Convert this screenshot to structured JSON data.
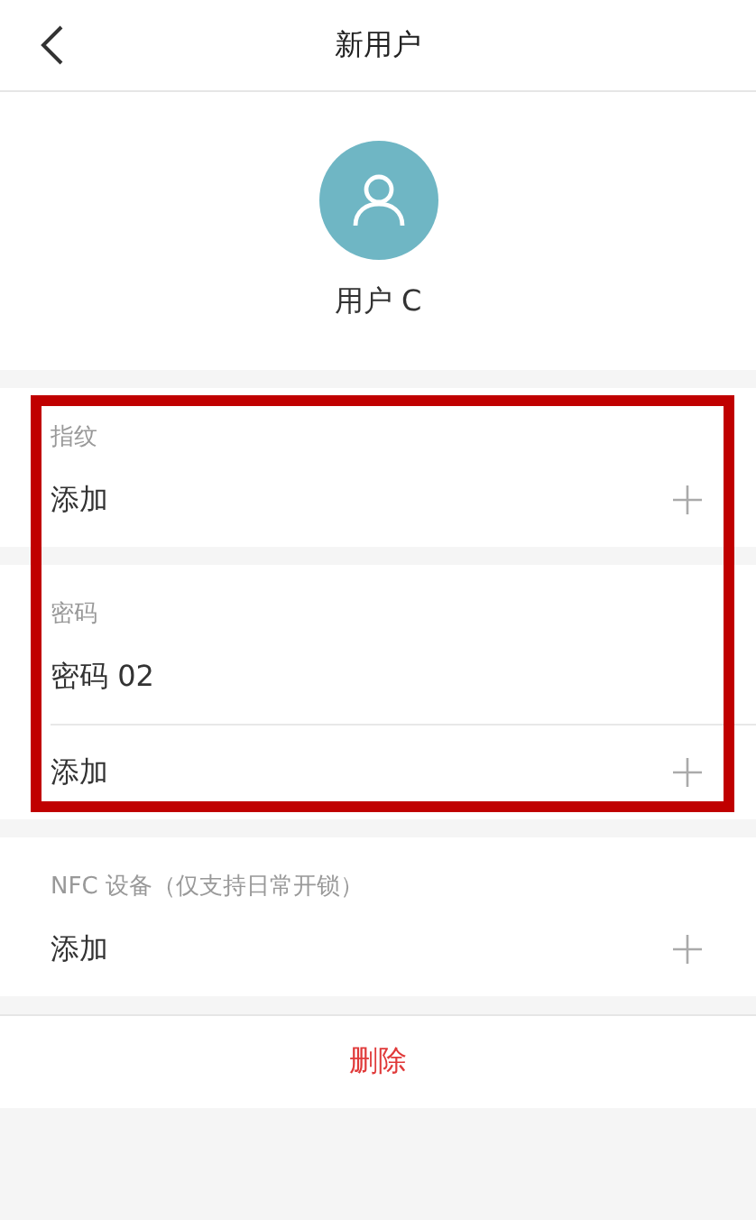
{
  "header": {
    "title": "新用户"
  },
  "profile": {
    "name": "用户 C"
  },
  "sections": [
    {
      "label": "指纹",
      "highlighted": true,
      "items": [
        {
          "kind": "add",
          "text": "添加"
        }
      ]
    },
    {
      "label": "密码",
      "highlighted": true,
      "items": [
        {
          "kind": "entry",
          "text": "密码 02"
        },
        {
          "kind": "add",
          "text": "添加"
        }
      ]
    },
    {
      "label": "NFC 设备（仅支持日常开锁）",
      "highlighted": false,
      "items": [
        {
          "kind": "add",
          "text": "添加"
        }
      ]
    }
  ],
  "delete_button": {
    "text": "删除"
  }
}
